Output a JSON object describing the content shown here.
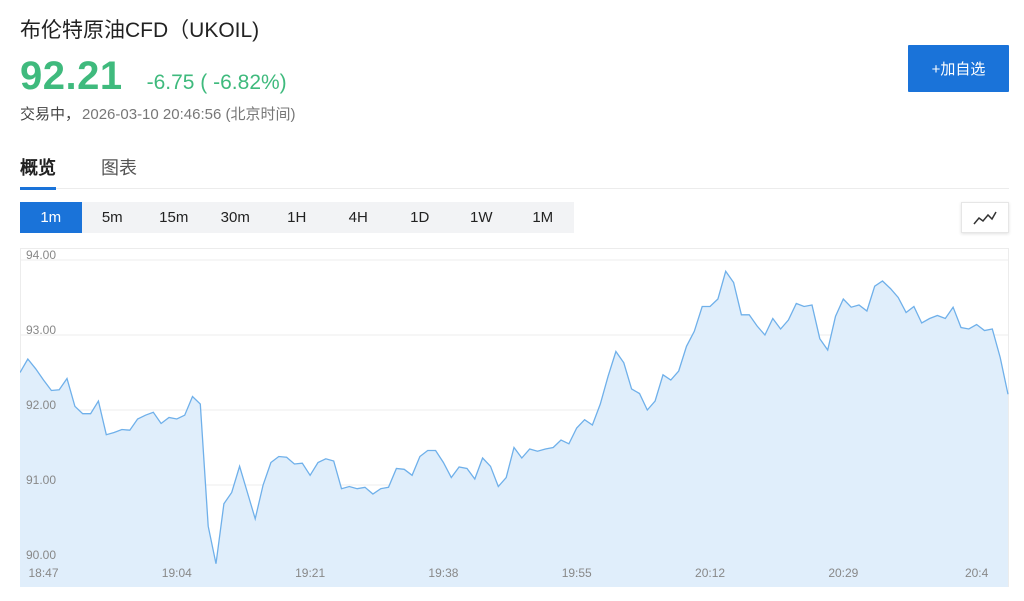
{
  "header": {
    "title": "布伦特原油CFD（UKOIL)",
    "price": "92.21",
    "change": "-6.75 ( -6.82%)",
    "status_label": "交易中，",
    "status_time": "2026-03-10 20:46:56 (北京时间)",
    "add_button_label": "+加自选"
  },
  "tabs": [
    {
      "label": "概览",
      "active": true
    },
    {
      "label": "图表",
      "active": false
    }
  ],
  "intervals": [
    {
      "label": "1m",
      "active": true
    },
    {
      "label": "5m",
      "active": false
    },
    {
      "label": "15m",
      "active": false
    },
    {
      "label": "30m",
      "active": false
    },
    {
      "label": "1H",
      "active": false
    },
    {
      "label": "4H",
      "active": false
    },
    {
      "label": "1D",
      "active": false
    },
    {
      "label": "1W",
      "active": false
    },
    {
      "label": "1M",
      "active": false
    }
  ],
  "chart_type_icon": "line-chart-icon",
  "colors": {
    "up_down": "#3fba7d",
    "accent": "#1a73d9",
    "line": "#6fb0ea",
    "fill": "#e0eefb"
  },
  "chart_data": {
    "type": "area",
    "ylim": [
      90,
      94
    ],
    "yticks": [
      "94.00",
      "93.00",
      "92.00",
      "91.00",
      "90.00"
    ],
    "xticks": [
      {
        "label": "18:47",
        "minute": 0
      },
      {
        "label": "19:04",
        "minute": 17
      },
      {
        "label": "19:21",
        "minute": 34
      },
      {
        "label": "19:38",
        "minute": 51
      },
      {
        "label": "19:55",
        "minute": 68
      },
      {
        "label": "20:12",
        "minute": 85
      },
      {
        "label": "20:29",
        "minute": 102
      },
      {
        "label": "20:4",
        "minute": 119
      }
    ],
    "x_start": "18:44",
    "x_end": "20:46",
    "values": [
      92.5,
      92.68,
      92.55,
      92.4,
      92.26,
      92.27,
      92.42,
      92.05,
      91.95,
      91.95,
      92.12,
      91.67,
      91.7,
      91.74,
      91.73,
      91.88,
      91.93,
      91.97,
      91.82,
      91.9,
      91.88,
      91.93,
      92.18,
      92.08,
      90.45,
      89.95,
      90.75,
      90.9,
      91.25,
      90.9,
      90.55,
      91.0,
      91.3,
      91.38,
      91.37,
      91.28,
      91.29,
      91.13,
      91.3,
      91.35,
      91.32,
      90.95,
      90.98,
      90.95,
      90.97,
      90.88,
      90.95,
      90.97,
      91.22,
      91.21,
      91.13,
      91.38,
      91.46,
      91.46,
      91.3,
      91.1,
      91.24,
      91.22,
      91.08,
      91.36,
      91.25,
      90.98,
      91.1,
      91.5,
      91.36,
      91.48,
      91.45,
      91.48,
      91.5,
      91.6,
      91.55,
      91.76,
      91.87,
      91.8,
      92.08,
      92.45,
      92.78,
      92.63,
      92.28,
      92.22,
      92.0,
      92.12,
      92.47,
      92.4,
      92.52,
      92.85,
      93.05,
      93.38,
      93.38,
      93.48,
      93.85,
      93.7,
      93.27,
      93.27,
      93.12,
      93.0,
      93.22,
      93.08,
      93.2,
      93.42,
      93.38,
      93.4,
      92.95,
      92.8,
      93.25,
      93.48,
      93.37,
      93.4,
      93.32,
      93.65,
      93.72,
      93.62,
      93.5,
      93.3,
      93.38,
      93.16,
      93.22,
      93.26,
      93.22,
      93.37,
      93.1,
      93.08,
      93.14,
      93.06,
      93.08,
      92.7,
      92.21
    ]
  }
}
